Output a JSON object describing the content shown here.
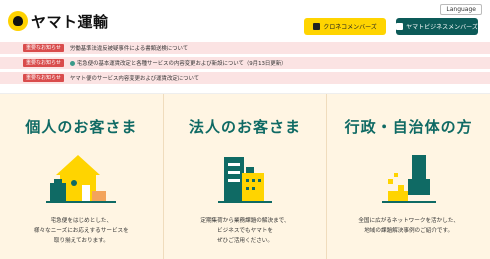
{
  "header": {
    "logo_text": "ヤマト運輸",
    "language_label": "Language",
    "kuroneko_label": "クロネコメンバーズ",
    "business_label": "ヤマトビジネスメンバーズ"
  },
  "notices": [
    {
      "badge": "重要なお知らせ",
      "text": "労働基準法違反被疑事件による書類送検について"
    },
    {
      "badge": "重要なお知らせ",
      "text": "宅急便の基本運賃改定と各種サービスの内容変更および新設について（9月13日更新）"
    },
    {
      "badge": "重要なお知らせ",
      "text": "ヤマト便のサービス内容変更および運賃改定について"
    }
  ],
  "panels": [
    {
      "title": "個人のお客さま",
      "desc": [
        "宅急便をはじめとした、",
        "様々なニーズにお応えするサービスを",
        "取り揃えております。"
      ]
    },
    {
      "title": "法人のお客さま",
      "desc": [
        "定期集荷から業務課題の解決まで、",
        "ビジネスでもヤマトを",
        "ぜひご活用ください。"
      ]
    },
    {
      "title": "行政・自治体の方",
      "desc": [
        "全国に広がるネットワークを活かした、",
        "地域の課題解決事例のご紹介です。"
      ]
    }
  ],
  "colors": {
    "accent_teal": "#0f6a64",
    "brand_yellow": "#ffd400",
    "business_green": "#0c5a58",
    "notice_bg": "#fbe3e3",
    "badge_red": "#d94c4c",
    "panel_bg": "#fff5e3"
  }
}
